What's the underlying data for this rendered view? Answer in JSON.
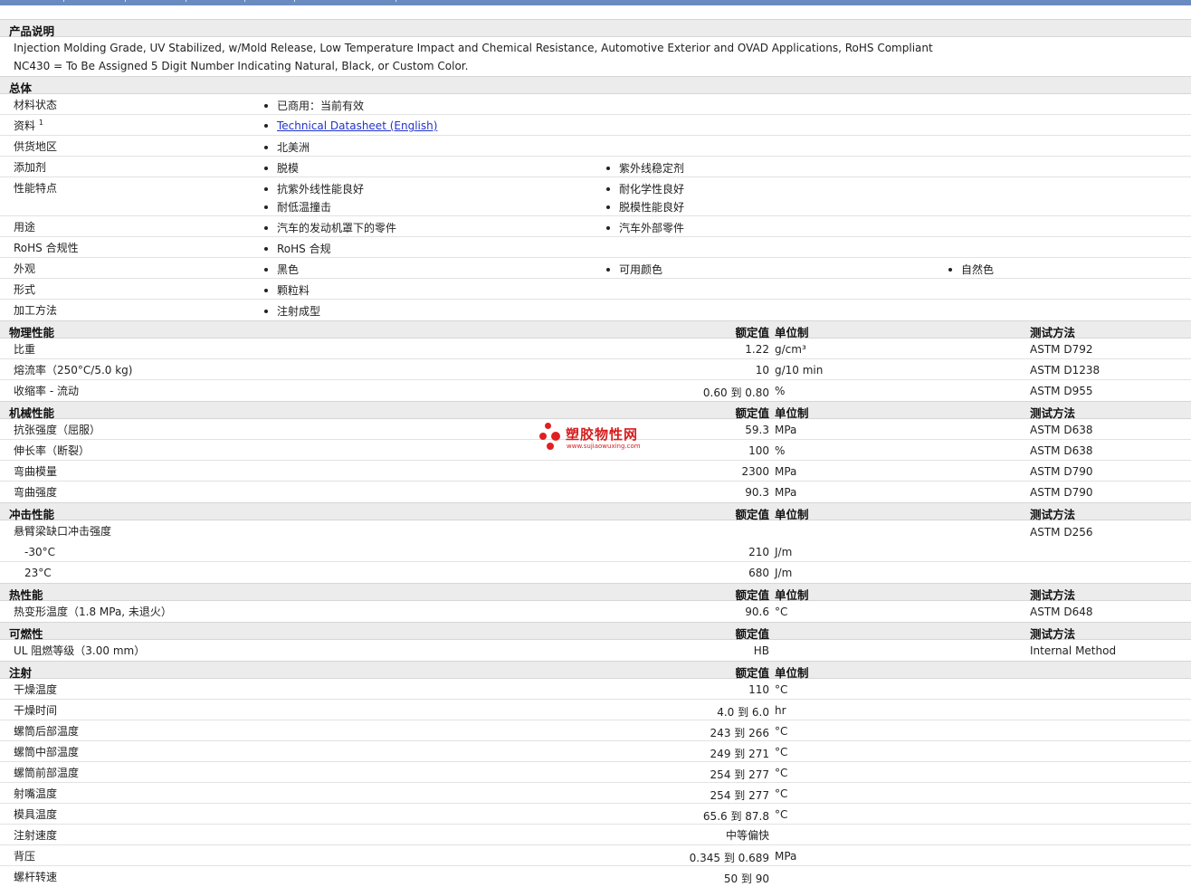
{
  "description": {
    "title": "产品说明",
    "lines": [
      "Injection Molding Grade, UV Stabilized, w/Mold Release, Low Temperature Impact and Chemical Resistance, Automotive Exterior and OVAD Applications, RoHS Compliant",
      "NC430 = To Be Assigned 5 Digit Number Indicating Natural, Black, or Custom Color."
    ]
  },
  "general": {
    "title": "总体",
    "rows": [
      {
        "label": "材料状态",
        "items": [
          "已商用：当前有效"
        ]
      },
      {
        "label": "资料",
        "sup": "1",
        "items": [
          "Technical Datasheet (English)"
        ]
      },
      {
        "label": "供货地区",
        "items": [
          "北美洲"
        ]
      },
      {
        "label": "添加剂",
        "items": [
          "脱模",
          "紫外线稳定剂"
        ]
      },
      {
        "label": "性能特点",
        "items": [
          "抗紫外线性能良好",
          "耐化学性良好",
          "耐低温撞击",
          "脱模性能良好"
        ]
      },
      {
        "label": "用途",
        "items": [
          "汽车的发动机罩下的零件",
          "汽车外部零件"
        ]
      },
      {
        "label": "RoHS 合规性",
        "items": [
          "RoHS 合规"
        ]
      },
      {
        "label": "外观",
        "items": [
          "黑色",
          "可用颜色",
          "自然色"
        ]
      },
      {
        "label": "形式",
        "items": [
          "颗粒料"
        ]
      },
      {
        "label": "加工方法",
        "items": [
          "注射成型"
        ]
      }
    ]
  },
  "headers": {
    "nominal": "额定值",
    "unit": "单位制",
    "method": "测试方法"
  },
  "physical": {
    "title": "物理性能",
    "rows": [
      {
        "label": "比重",
        "value": "1.22",
        "unit": "g/cm³",
        "method": "ASTM D792"
      },
      {
        "label": "熔流率（250°C/5.0 kg)",
        "value": "10",
        "unit": "g/10 min",
        "method": "ASTM D1238"
      },
      {
        "label": "收缩率 - 流动",
        "value": "0.60 到 0.80",
        "unit": "%",
        "method": "ASTM D955"
      }
    ]
  },
  "mechanical": {
    "title": "机械性能",
    "rows": [
      {
        "label": "抗张强度（屈服）",
        "value": "59.3",
        "unit": "MPa",
        "method": "ASTM D638"
      },
      {
        "label": "伸长率（断裂）",
        "value": "100",
        "unit": "%",
        "method": "ASTM D638"
      },
      {
        "label": "弯曲模量",
        "value": "2300",
        "unit": "MPa",
        "method": "ASTM D790"
      },
      {
        "label": "弯曲强度",
        "value": "90.3",
        "unit": "MPa",
        "method": "ASTM D790"
      }
    ]
  },
  "impact": {
    "title": "冲击性能",
    "group_label": "悬臂梁缺口冲击强度",
    "group_method": "ASTM D256",
    "rows": [
      {
        "label": "-30°C",
        "value": "210",
        "unit": "J/m"
      },
      {
        "label": "23°C",
        "value": "680",
        "unit": "J/m"
      }
    ]
  },
  "thermal": {
    "title": "热性能",
    "rows": [
      {
        "label": "热变形温度（1.8 MPa, 未退火）",
        "value": "90.6",
        "unit": "°C",
        "method": "ASTM D648"
      }
    ]
  },
  "flammability": {
    "title": "可燃性",
    "rows": [
      {
        "label": "UL 阻燃等级（3.00 mm）",
        "value": "HB",
        "unit": "",
        "method": "Internal Method"
      }
    ]
  },
  "injection": {
    "title": "注射",
    "rows": [
      {
        "label": "干燥温度",
        "value": "110",
        "unit": "°C"
      },
      {
        "label": "干燥时间",
        "value": "4.0 到 6.0",
        "unit": "hr"
      },
      {
        "label": "螺筒后部温度",
        "value": "243 到 266",
        "unit": "°C"
      },
      {
        "label": "螺筒中部温度",
        "value": "249 到 271",
        "unit": "°C"
      },
      {
        "label": "螺筒前部温度",
        "value": "254 到 277",
        "unit": "°C"
      },
      {
        "label": "射嘴温度",
        "value": "254 到 277",
        "unit": "°C"
      },
      {
        "label": "模具温度",
        "value": "65.6 到 87.8",
        "unit": "°C"
      },
      {
        "label": "注射速度",
        "value": "中等偏快",
        "unit": ""
      },
      {
        "label": "背压",
        "value": "0.345 到 0.689",
        "unit": "MPa"
      },
      {
        "label": "螺杆转速",
        "value": "50 到 90",
        "unit": ""
      }
    ]
  },
  "watermark": {
    "text": "塑胶物性网",
    "url": "www.sujiaowuxing.com"
  }
}
